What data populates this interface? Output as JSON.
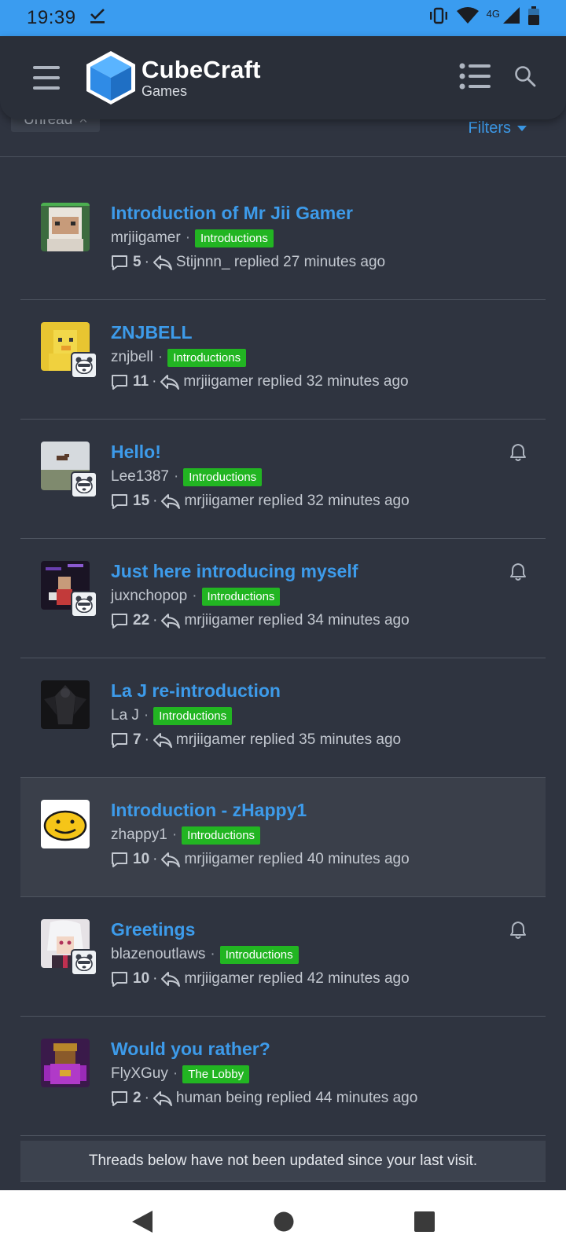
{
  "status": {
    "time": "19:39",
    "network": "4G"
  },
  "header": {
    "brand": "CubeCraft",
    "sub": "Games"
  },
  "filters": {
    "chip_label": "Unread",
    "chip_remove": "×",
    "filters_label": "Filters"
  },
  "threads": [
    {
      "title": "Introduction of Mr Jii Gamer",
      "author": "mrjiigamer",
      "tag": "Introductions",
      "replies": "5",
      "last": "Stijnnn_ replied 27 minutes ago",
      "watched": false,
      "badge": false
    },
    {
      "title": "ZNJBELL",
      "author": "znjbell",
      "tag": "Introductions",
      "replies": "11",
      "last": "mrjiigamer replied 32 minutes ago",
      "watched": false,
      "badge": true
    },
    {
      "title": "Hello!",
      "author": "Lee1387",
      "tag": "Introductions",
      "replies": "15",
      "last": "mrjiigamer replied 32 minutes ago",
      "watched": true,
      "badge": true
    },
    {
      "title": "Just here introducing myself",
      "author": "juxnchopop",
      "tag": "Introductions",
      "replies": "22",
      "last": "mrjiigamer replied 34 minutes ago",
      "watched": true,
      "badge": true
    },
    {
      "title": "La J re-introduction",
      "author": "La J",
      "tag": "Introductions",
      "replies": "7",
      "last": "mrjiigamer replied 35 minutes ago",
      "watched": false,
      "badge": false
    },
    {
      "title": "Introduction - zHappy1",
      "author": "zhappy1",
      "tag": "Introductions",
      "replies": "10",
      "last": "mrjiigamer replied 40 minutes ago",
      "watched": false,
      "badge": false
    },
    {
      "title": "Greetings",
      "author": "blazenoutlaws",
      "tag": "Introductions",
      "replies": "10",
      "last": "mrjiigamer replied 42 minutes ago",
      "watched": true,
      "badge": true
    },
    {
      "title": "Would you rather?",
      "author": "FlyXGuy",
      "tag": "The Lobby",
      "replies": "2",
      "last": "human being replied 44 minutes ago",
      "watched": false,
      "badge": false
    }
  ],
  "notice": "Threads below have not been updated since your last visit."
}
